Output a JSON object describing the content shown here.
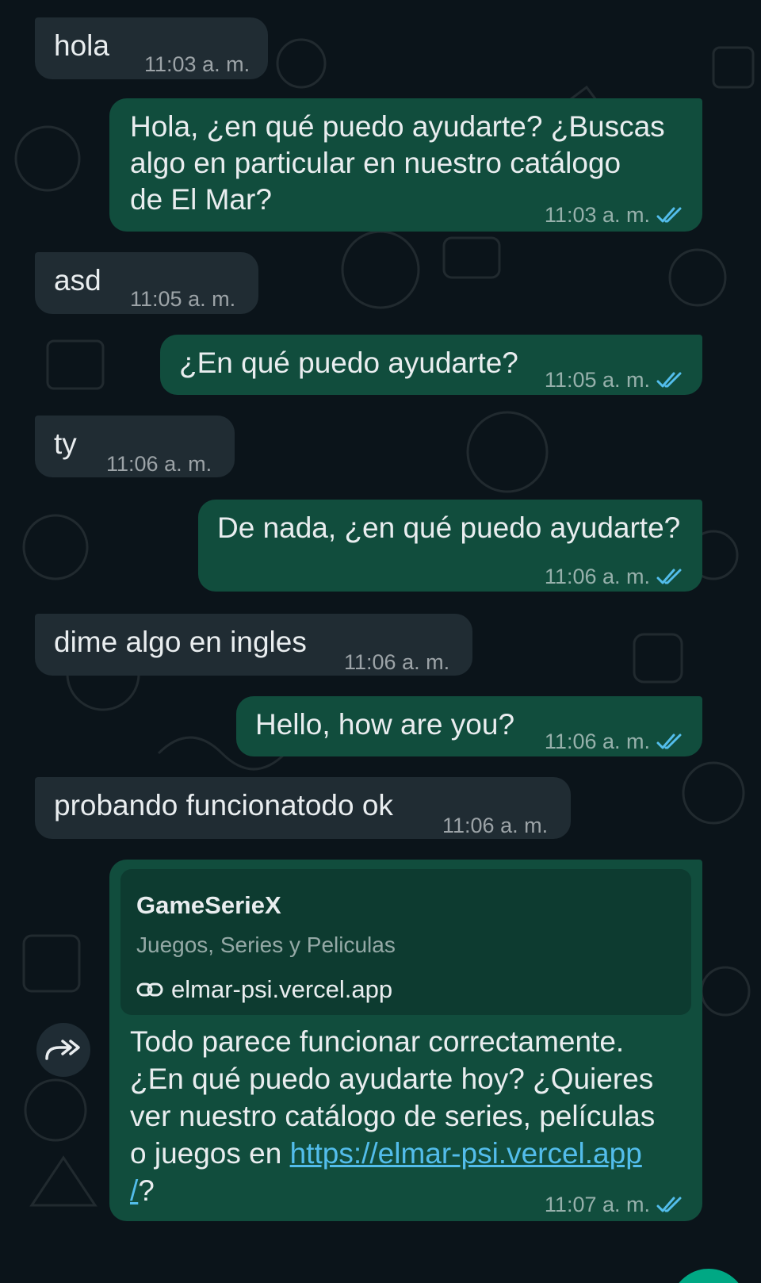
{
  "theme": {
    "background": "#0b141a",
    "incoming_bubble": "#202c33",
    "outgoing_bubble": "#114d3d",
    "read_ticks": "#53bdeb",
    "link": "#53bdeb"
  },
  "messages": [
    {
      "direction": "incoming",
      "text": "hola",
      "time": "11:03 a. m."
    },
    {
      "direction": "outgoing",
      "lines": [
        "Hola, ¿en qué puedo ayudarte? ¿Buscas",
        "algo en particular en nuestro catálogo",
        "de El Mar?"
      ],
      "time": "11:03 a. m.",
      "status": "read"
    },
    {
      "direction": "incoming",
      "text": "asd",
      "time": "11:05 a. m."
    },
    {
      "direction": "outgoing",
      "text": "¿En qué puedo ayudarte?",
      "time": "11:05 a. m.",
      "status": "read"
    },
    {
      "direction": "incoming",
      "text": "ty",
      "time": "11:06 a. m."
    },
    {
      "direction": "outgoing",
      "text": "De nada, ¿en qué puedo ayudarte?",
      "time": "11:06 a. m.",
      "status": "read"
    },
    {
      "direction": "incoming",
      "text": "dime algo en ingles",
      "time": "11:06 a. m."
    },
    {
      "direction": "outgoing",
      "text": "Hello, how are you?",
      "time": "11:06 a. m.",
      "status": "read"
    },
    {
      "direction": "incoming",
      "text": "probando funcionatodo ok",
      "time": "11:06 a. m."
    },
    {
      "direction": "outgoing",
      "link_preview": {
        "title": "GameSerieX",
        "description": "Juegos, Series y Peliculas",
        "domain": "elmar-psi.vercel.app",
        "icon": "link-icon"
      },
      "lines": [
        "Todo parece funcionar correctamente.",
        "¿En qué puedo ayudarte hoy? ¿Quieres",
        "ver nuestro catálogo de series, películas"
      ],
      "line4_prefix": "o juegos en ",
      "url_part1": "https://elmar-psi.vercel.app",
      "url_part2": "/",
      "line5_suffix": "?",
      "time": "11:07 a. m.",
      "status": "read"
    }
  ],
  "icons": {
    "forward": "forward-icon",
    "read_receipt": "double-check-icon"
  }
}
